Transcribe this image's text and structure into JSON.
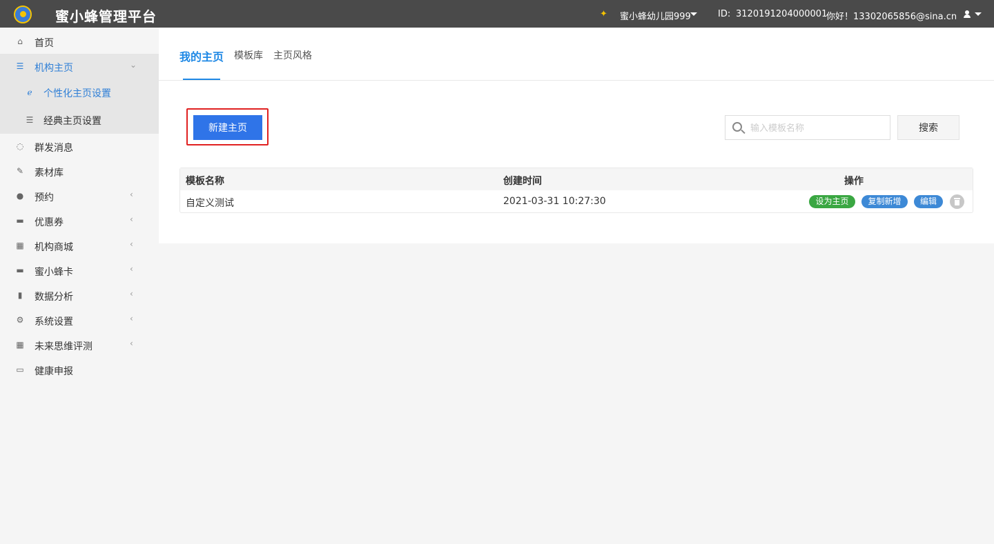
{
  "header": {
    "brand": "蜜小蜂管理平台",
    "org_name": "蜜小蜂幼儿园999",
    "id_label": "ID:",
    "id_value": "3120191204000001",
    "greeting": "你好！13302065856@sina.cn"
  },
  "sidebar": {
    "items": [
      {
        "label": "首页",
        "icon": "home-icon"
      },
      {
        "label": "机构主页",
        "icon": "list-icon"
      },
      {
        "label": "群发消息",
        "icon": "chat-icon"
      },
      {
        "label": "素材库",
        "icon": "edit-icon"
      },
      {
        "label": "预约",
        "icon": "users-icon"
      },
      {
        "label": "优惠券",
        "icon": "card-icon"
      },
      {
        "label": "机构商城",
        "icon": "building-icon"
      },
      {
        "label": "蜜小蜂卡",
        "icon": "card-icon"
      },
      {
        "label": "数据分析",
        "icon": "bar-chart-icon"
      },
      {
        "label": "系统设置",
        "icon": "gears-icon"
      },
      {
        "label": "未来思维评测",
        "icon": "building-icon"
      },
      {
        "label": "健康申报",
        "icon": "id-card-icon"
      }
    ],
    "sub_items": [
      {
        "label": "个性化主页设置",
        "icon": "ie-icon"
      },
      {
        "label": "经典主页设置",
        "icon": "list-icon"
      }
    ]
  },
  "tabs": [
    "我的主页",
    "模板库",
    "主页风格"
  ],
  "toolbar": {
    "new_button": "新建主页",
    "search_placeholder": "输入模板名称",
    "search_button": "搜索"
  },
  "table": {
    "headers": [
      "模板名称",
      "创建时间",
      "操作"
    ],
    "rows": [
      {
        "name": "自定义测试",
        "created": "2021-03-31 10:27:30"
      }
    ],
    "actions": [
      "设为主页",
      "复制新增",
      "编辑"
    ]
  },
  "colors": {
    "topbar": "#4a4a4a",
    "accent": "#2f74e8",
    "highlight": "#e02020",
    "green_tag": "#3aa742",
    "blue_tag": "#3d89d6"
  }
}
